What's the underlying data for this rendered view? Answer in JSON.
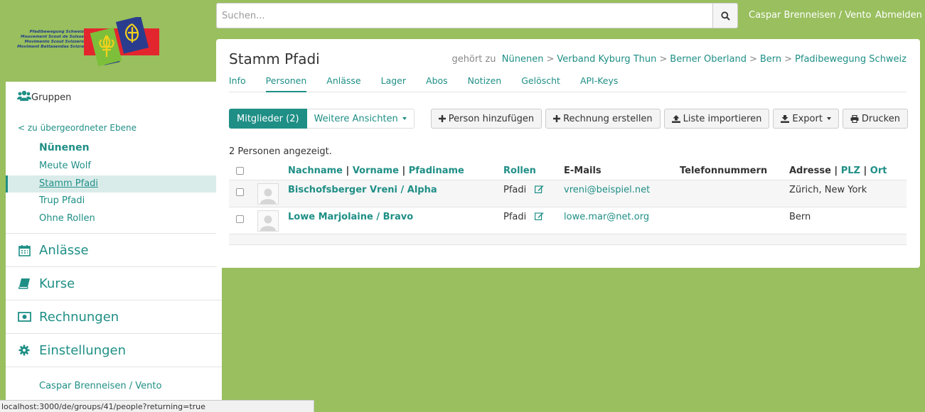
{
  "logo": {
    "lines": [
      "Pfadibewegung Schweiz",
      "Mouvement Scout de Suisse",
      "Movimento Scout Svizzero",
      "Moviment Battasendas Svizra"
    ],
    "colors": {
      "red": "#e3262e",
      "blue": "#2a3c8d",
      "green": "#7dbf3a",
      "yellow": "#f3d11b"
    }
  },
  "header": {
    "search_placeholder": "Suchen...",
    "user_name": "Caspar Brenneisen / Vento",
    "logout": "Abmelden"
  },
  "sidebar": {
    "groups_title": "Gruppen",
    "up_link": "< zu übergeordneter Ebene",
    "parent": "Nünenen",
    "items": [
      "Meute Wolf",
      "Stamm Pfadi",
      "Trup Pfadi",
      "Ohne Rollen"
    ],
    "active_item": "Stamm Pfadi",
    "sections": [
      "Anlässe",
      "Kurse",
      "Rechnungen",
      "Einstellungen"
    ],
    "user": "Caspar Brenneisen / Vento"
  },
  "page": {
    "title": "Stamm Pfadi",
    "crumbs_prefix": "gehört zu",
    "crumbs": [
      "Nünenen",
      "Verband Kyburg Thun",
      "Berner Oberland",
      "Bern",
      "Pfadibewegung Schweiz"
    ],
    "tabs": [
      "Info",
      "Personen",
      "Anlässe",
      "Lager",
      "Abos",
      "Notizen",
      "Gelöscht",
      "API-Keys"
    ],
    "active_tab": "Personen"
  },
  "toolbar": {
    "members": "Mitglieder (2)",
    "more_views": "Weitere Ansichten",
    "add_person": "Person hinzufügen",
    "create_invoice": "Rechnung erstellen",
    "import_list": "Liste importieren",
    "export": "Export",
    "print": "Drucken"
  },
  "people": {
    "count_text": "2 Personen angezeigt.",
    "columns": {
      "lastname": "Nachname",
      "firstname": "Vorname",
      "nickname": "Pfadiname",
      "roles": "Rollen",
      "emails": "E-Mails",
      "phones": "Telefonnummern",
      "address": "Adresse",
      "zip": "PLZ",
      "town": "Ort",
      "sep": "|"
    },
    "rows": [
      {
        "name": "Bischofsberger Vreni / Alpha",
        "role": "Pfadi",
        "email": "vreni@beispiel.net",
        "phone": "",
        "address": "Zürich, New York"
      },
      {
        "name": "Lowe Marjolaine / Bravo",
        "role": "Pfadi",
        "email": "lowe.mar@net.org",
        "phone": "",
        "address": "Bern"
      }
    ]
  },
  "statusbar": {
    "url": "localhost:3000/de/groups/41/people?returning=true"
  },
  "colors": {
    "background": "#99bf5e",
    "accent": "#1f8f86",
    "active_bg": "#daecea"
  }
}
